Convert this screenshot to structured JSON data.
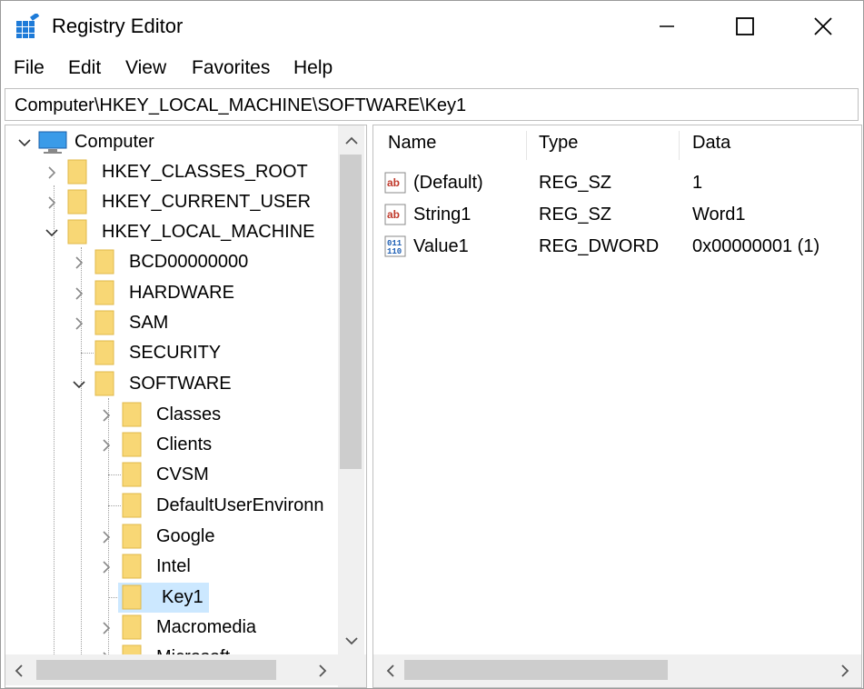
{
  "window": {
    "title": "Registry Editor"
  },
  "menu": [
    "File",
    "Edit",
    "View",
    "Favorites",
    "Help"
  ],
  "address": "Computer\\HKEY_LOCAL_MACHINE\\SOFTWARE\\Key1",
  "tree": {
    "root": "Computer",
    "hives": [
      "HKEY_CLASSES_ROOT",
      "HKEY_CURRENT_USER",
      "HKEY_LOCAL_MACHINE"
    ],
    "hklm_children": [
      "BCD00000000",
      "HARDWARE",
      "SAM",
      "SECURITY",
      "SOFTWARE"
    ],
    "software_children": [
      "Classes",
      "Clients",
      "CVSM",
      "DefaultUserEnvironn",
      "Google",
      "Intel",
      "Key1",
      "Macromedia",
      "Microsoft"
    ],
    "selected": "Key1"
  },
  "values": {
    "columns": [
      "Name",
      "Type",
      "Data"
    ],
    "rows": [
      {
        "name": "(Default)",
        "type": "REG_SZ",
        "data": "1",
        "icon": "string-value-icon"
      },
      {
        "name": "String1",
        "type": "REG_SZ",
        "data": "Word1",
        "icon": "string-value-icon"
      },
      {
        "name": "Value1",
        "type": "REG_DWORD",
        "data": "0x00000001 (1)",
        "icon": "binary-value-icon"
      }
    ]
  },
  "colors": {
    "selection": "#cce8ff",
    "folder": "#f8d775",
    "scroll_track": "#f0f0f0",
    "scroll_thumb": "#cdcdcd"
  }
}
